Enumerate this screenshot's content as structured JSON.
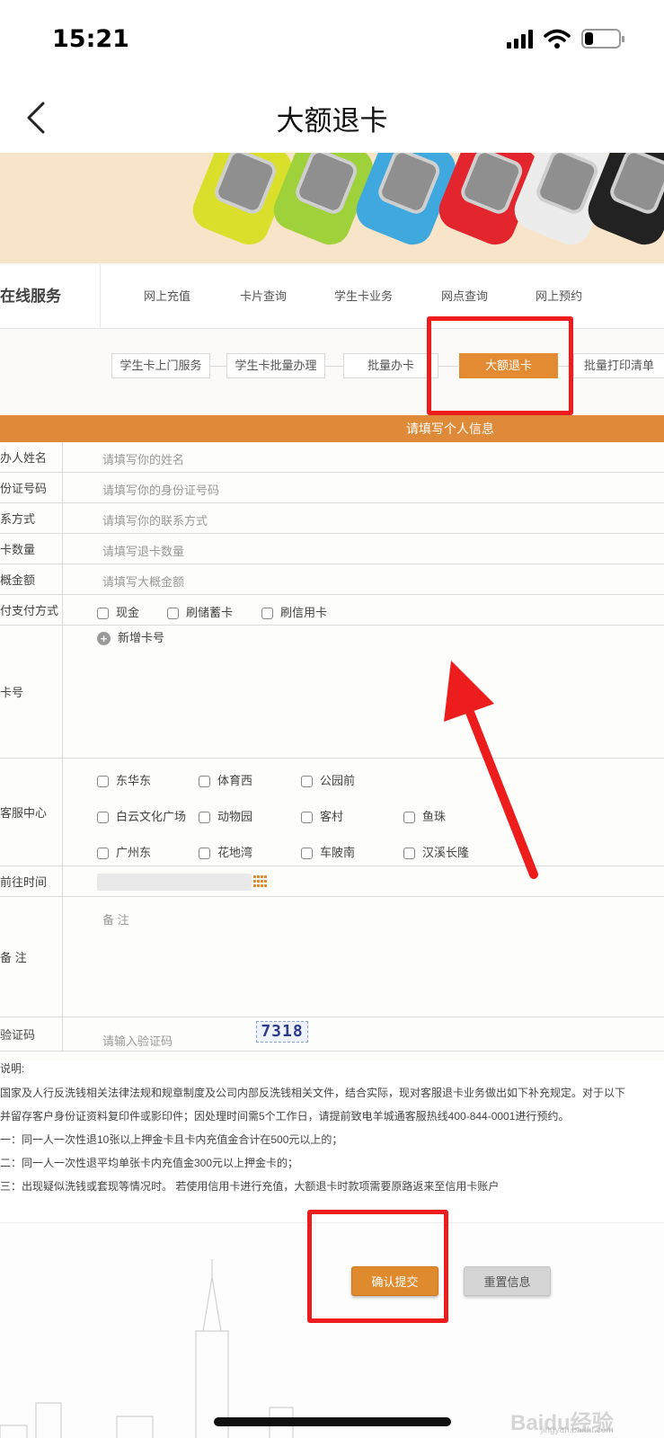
{
  "status_bar": {
    "time": "15:21",
    "battery_level": 0.25
  },
  "nav": {
    "title": "大额退卡"
  },
  "service": {
    "title": "在线服务",
    "links": [
      "网上充值",
      "卡片查询",
      "学生卡业务",
      "网点查询",
      "网上预约"
    ]
  },
  "sub_tabs": [
    {
      "label": "学生卡上门服务",
      "active": false
    },
    {
      "label": "学生卡批量办理",
      "active": false
    },
    {
      "label": "批量办卡",
      "active": false
    },
    {
      "label": "大额退卡",
      "active": true
    },
    {
      "label": "批量打印清单",
      "active": false
    }
  ],
  "form": {
    "header": "请填写个人信息",
    "name": {
      "label": "办人姓名",
      "placeholder": "请填写你的姓名"
    },
    "id_number": {
      "label": "份证号码",
      "placeholder": "请填写你的身份证号码"
    },
    "contact": {
      "label": "系方式",
      "placeholder": "请填写你的联系方式"
    },
    "card_count": {
      "label": "卡数量",
      "placeholder": "请填写退卡数量"
    },
    "amount": {
      "label": "概金额",
      "placeholder": "请填写大概金额"
    },
    "payment": {
      "label": "付支付方式",
      "options": [
        "现金",
        "刷储蓄卡",
        "刷信用卡"
      ]
    },
    "card_number": {
      "label": "卡号",
      "add_label": "新增卡号"
    },
    "service_center": {
      "label": "客服中心",
      "options": [
        "东华东",
        "体育西",
        "公园前",
        "白云文化广场",
        "动物园",
        "客村",
        "鱼珠",
        "广州东",
        "花地湾",
        "车陂南",
        "汉溪长隆"
      ]
    },
    "visit_time": {
      "label": "前往时间"
    },
    "remark": {
      "label": "备 注",
      "placeholder": "备 注"
    },
    "captcha": {
      "label": "验证码",
      "placeholder": "请输入验证码",
      "code": "7318"
    }
  },
  "notes": {
    "title": "说明:",
    "lines": [
      "国家及人行反洗钱相关法律法规和规章制度及公司内部反洗钱相关文件，结合实际，现对客服退卡业务做出如下补充规定。对于以下",
      "并留存客户身份证资料复印件或影印件；因处理时间需5个工作日，请提前致电羊城通客服热线400-844-0001进行预约。",
      "一：同一人一次性退10张以上押金卡且卡内充值金合计在500元以上的；",
      "二：同一人一次性退平均单张卡内充值金300元以上押金卡的；",
      "三：出现疑似洗钱或套现等情况时。 若使用信用卡进行充值，大额退卡时款项需要原路返来至信用卡账户"
    ]
  },
  "buttons": {
    "submit": "确认提交",
    "reset": "重置信息"
  },
  "watermark": {
    "text": "Baidu经验",
    "sub": "jingyan.baidu.com"
  },
  "colors": {
    "accent": "#df8a38",
    "annotation": "#ee1d1d"
  }
}
